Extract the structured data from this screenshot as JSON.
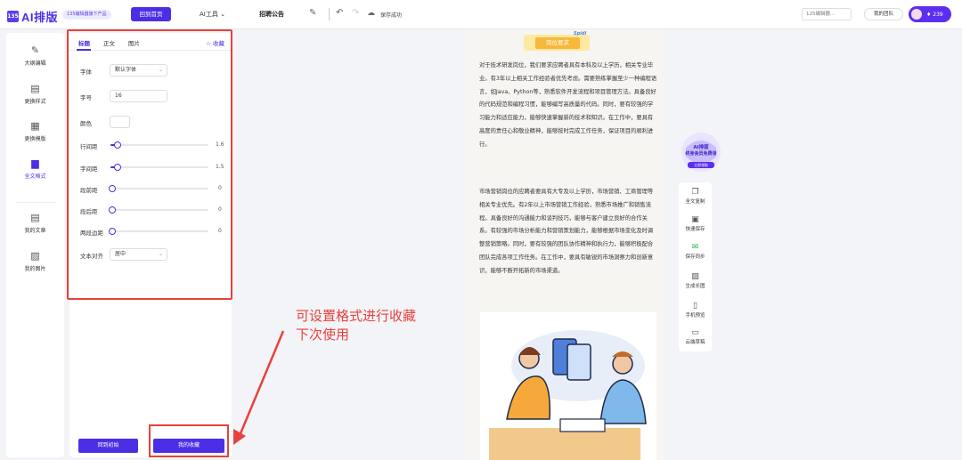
{
  "header": {
    "logo_mark": "135",
    "logo_text": "AI排版",
    "sub_badge": "135编辑器旗下产品",
    "home_button": "回到首页",
    "ai_tools": "AI工具 ⌄",
    "doc_title": "招聘公告",
    "save_status": "保存成功",
    "editor_select": "125编辑器...",
    "team_button": "我的团队",
    "vip_count": "♦ 239"
  },
  "leftnav": {
    "items": [
      {
        "label": "大纲编辑",
        "icon": "pen-icon"
      },
      {
        "label": "更换样式",
        "icon": "style-icon"
      },
      {
        "label": "更换模版",
        "icon": "template-icon"
      },
      {
        "label": "全文格式",
        "icon": "format-icon"
      },
      {
        "label": "我的文章",
        "icon": "article-icon"
      },
      {
        "label": "我的图片",
        "icon": "image-icon"
      }
    ]
  },
  "panel": {
    "tabs": [
      "标题",
      "正文",
      "图片"
    ],
    "active_tab": "标题",
    "fav_label": "☆ 收藏",
    "font_label": "字体",
    "font_value": "默认字体",
    "size_label": "字号",
    "size_value": "16",
    "color_label": "颜色",
    "line_height_label": "行间距",
    "line_height_value": "1.6",
    "letter_spacing_label": "字间距",
    "letter_spacing_value": "1.5",
    "before_label": "段前距",
    "before_value": "0",
    "after_label": "段后距",
    "after_value": "0",
    "side_label": "两段边距",
    "side_value": "0",
    "align_label": "文本对齐",
    "align_value": "居中",
    "reset_button": "回到初始",
    "fav_button": "我的收藏"
  },
  "annotation": {
    "line1": "可设置格式进行收藏",
    "line2": "下次使用"
  },
  "document": {
    "tag": "Spidi",
    "heading": "岗位要求",
    "para1": "对于技术研发岗位，我们要求应聘者具有本科及以上学历，相关专业毕业。有3年以上相关工作经验者优先考虑。需要熟练掌握至少一种编程语言，如Java、Python等，熟悉软件开发流程和项目管理方法。具备良好的代码规范和编程习惯，能够编写高质量的代码。同时，要有较强的学习能力和适应能力，能够快速掌握新的技术和知识。在工作中，要具有高度的责任心和敬业精神，能够按时完成工作任务，保证项目的顺利进行。",
    "para2": "市场营销岗位的应聘者要具有大专及以上学历，市场营销、工商管理等相关专业优先。有2年以上市场营销工作经验，熟悉市场推广和销售流程。具备良好的沟通能力和谈判技巧，能够与客户建立良好的合作关系。有较强的市场分析能力和营销策划能力，能够根据市场变化及时调整营销策略。同时，要有较强的团队协作精神和执行力，能够积极配合团队完成各项工作任务。在工作中，要具有敏锐的市场洞察力和创新意识，能够不断开拓新的市场渠道。"
  },
  "floating": {
    "promo_line1": "AI排版",
    "promo_line2": "终身会员免费领",
    "promo_btn": "立即领取",
    "items": [
      {
        "label": "全文复制",
        "icon": "copy-icon"
      },
      {
        "label": "快速保存",
        "icon": "save-icon"
      },
      {
        "label": "保存同步",
        "icon": "wechat-icon"
      },
      {
        "label": "生成长图",
        "icon": "longimage-icon"
      },
      {
        "label": "手机预览",
        "icon": "phone-icon"
      },
      {
        "label": "云端草稿",
        "icon": "cloud-draft-icon"
      }
    ]
  },
  "colors": {
    "accent": "#4b2fe6",
    "annotation": "#e8413d"
  }
}
